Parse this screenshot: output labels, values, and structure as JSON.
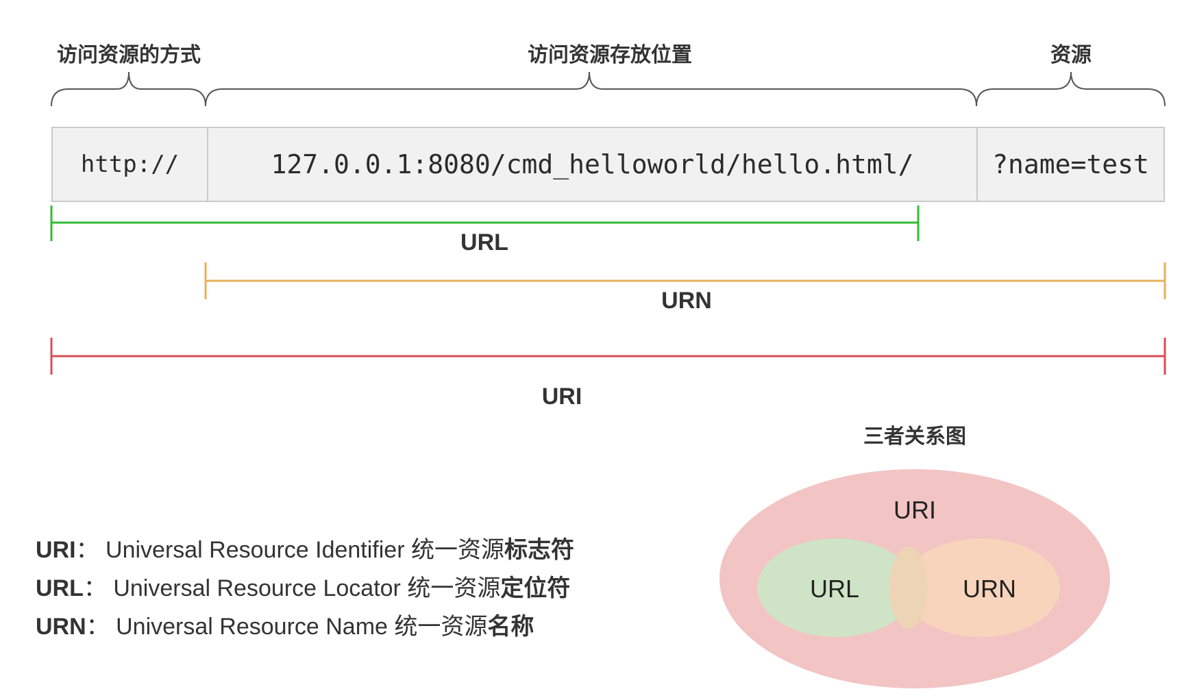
{
  "labels": {
    "scheme": "访问资源的方式",
    "location": "访问资源存放位置",
    "resource": "资源"
  },
  "url_parts": {
    "scheme": "http://",
    "path": "127.0.0.1:8080/cmd_helloworld/hello.html/",
    "query": "?name=test"
  },
  "ranges": {
    "url": {
      "label": "URL",
      "color": "#33bb33"
    },
    "urn": {
      "label": "URN",
      "color": "#e8b05a"
    },
    "uri": {
      "label": "URI",
      "color": "#d94c55"
    }
  },
  "diagram": {
    "title": "三者关系图",
    "outer_label": "URI",
    "left_label": "URL",
    "right_label": "URN",
    "outer_color": "#f2c4c4",
    "left_color": "#cfe4c6",
    "right_color": "#f8d4bc",
    "overlap_color": "#ecd4b4"
  },
  "legend": [
    {
      "abbr": "URI",
      "sep": "：",
      "full": "Universal Resource Identifier",
      "zh": "统一资源",
      "zh_bold": "标志符"
    },
    {
      "abbr": "URL",
      "sep": "：",
      "full": "Universal Resource Locator",
      "zh": "统一资源",
      "zh_bold": "定位符"
    },
    {
      "abbr": "URN",
      "sep": "：",
      "full": "Universal Resource Name",
      "zh": "统一资源",
      "zh_bold": "名称"
    }
  ]
}
